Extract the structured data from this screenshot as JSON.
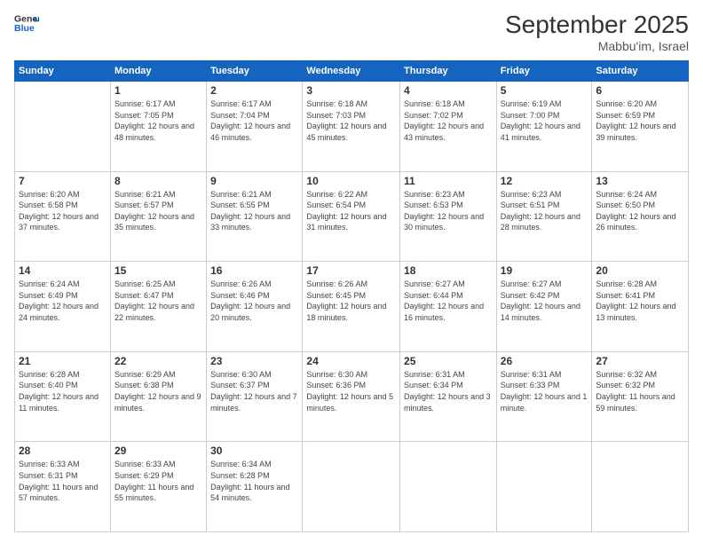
{
  "header": {
    "logo_line1": "General",
    "logo_line2": "Blue",
    "month_title": "September 2025",
    "location": "Mabbu'im, Israel"
  },
  "days_of_week": [
    "Sunday",
    "Monday",
    "Tuesday",
    "Wednesday",
    "Thursday",
    "Friday",
    "Saturday"
  ],
  "weeks": [
    [
      {
        "day": "",
        "sunrise": "",
        "sunset": "",
        "daylight": ""
      },
      {
        "day": "1",
        "sunrise": "Sunrise: 6:17 AM",
        "sunset": "Sunset: 7:05 PM",
        "daylight": "Daylight: 12 hours and 48 minutes."
      },
      {
        "day": "2",
        "sunrise": "Sunrise: 6:17 AM",
        "sunset": "Sunset: 7:04 PM",
        "daylight": "Daylight: 12 hours and 46 minutes."
      },
      {
        "day": "3",
        "sunrise": "Sunrise: 6:18 AM",
        "sunset": "Sunset: 7:03 PM",
        "daylight": "Daylight: 12 hours and 45 minutes."
      },
      {
        "day": "4",
        "sunrise": "Sunrise: 6:18 AM",
        "sunset": "Sunset: 7:02 PM",
        "daylight": "Daylight: 12 hours and 43 minutes."
      },
      {
        "day": "5",
        "sunrise": "Sunrise: 6:19 AM",
        "sunset": "Sunset: 7:00 PM",
        "daylight": "Daylight: 12 hours and 41 minutes."
      },
      {
        "day": "6",
        "sunrise": "Sunrise: 6:20 AM",
        "sunset": "Sunset: 6:59 PM",
        "daylight": "Daylight: 12 hours and 39 minutes."
      }
    ],
    [
      {
        "day": "7",
        "sunrise": "Sunrise: 6:20 AM",
        "sunset": "Sunset: 6:58 PM",
        "daylight": "Daylight: 12 hours and 37 minutes."
      },
      {
        "day": "8",
        "sunrise": "Sunrise: 6:21 AM",
        "sunset": "Sunset: 6:57 PM",
        "daylight": "Daylight: 12 hours and 35 minutes."
      },
      {
        "day": "9",
        "sunrise": "Sunrise: 6:21 AM",
        "sunset": "Sunset: 6:55 PM",
        "daylight": "Daylight: 12 hours and 33 minutes."
      },
      {
        "day": "10",
        "sunrise": "Sunrise: 6:22 AM",
        "sunset": "Sunset: 6:54 PM",
        "daylight": "Daylight: 12 hours and 31 minutes."
      },
      {
        "day": "11",
        "sunrise": "Sunrise: 6:23 AM",
        "sunset": "Sunset: 6:53 PM",
        "daylight": "Daylight: 12 hours and 30 minutes."
      },
      {
        "day": "12",
        "sunrise": "Sunrise: 6:23 AM",
        "sunset": "Sunset: 6:51 PM",
        "daylight": "Daylight: 12 hours and 28 minutes."
      },
      {
        "day": "13",
        "sunrise": "Sunrise: 6:24 AM",
        "sunset": "Sunset: 6:50 PM",
        "daylight": "Daylight: 12 hours and 26 minutes."
      }
    ],
    [
      {
        "day": "14",
        "sunrise": "Sunrise: 6:24 AM",
        "sunset": "Sunset: 6:49 PM",
        "daylight": "Daylight: 12 hours and 24 minutes."
      },
      {
        "day": "15",
        "sunrise": "Sunrise: 6:25 AM",
        "sunset": "Sunset: 6:47 PM",
        "daylight": "Daylight: 12 hours and 22 minutes."
      },
      {
        "day": "16",
        "sunrise": "Sunrise: 6:26 AM",
        "sunset": "Sunset: 6:46 PM",
        "daylight": "Daylight: 12 hours and 20 minutes."
      },
      {
        "day": "17",
        "sunrise": "Sunrise: 6:26 AM",
        "sunset": "Sunset: 6:45 PM",
        "daylight": "Daylight: 12 hours and 18 minutes."
      },
      {
        "day": "18",
        "sunrise": "Sunrise: 6:27 AM",
        "sunset": "Sunset: 6:44 PM",
        "daylight": "Daylight: 12 hours and 16 minutes."
      },
      {
        "day": "19",
        "sunrise": "Sunrise: 6:27 AM",
        "sunset": "Sunset: 6:42 PM",
        "daylight": "Daylight: 12 hours and 14 minutes."
      },
      {
        "day": "20",
        "sunrise": "Sunrise: 6:28 AM",
        "sunset": "Sunset: 6:41 PM",
        "daylight": "Daylight: 12 hours and 13 minutes."
      }
    ],
    [
      {
        "day": "21",
        "sunrise": "Sunrise: 6:28 AM",
        "sunset": "Sunset: 6:40 PM",
        "daylight": "Daylight: 12 hours and 11 minutes."
      },
      {
        "day": "22",
        "sunrise": "Sunrise: 6:29 AM",
        "sunset": "Sunset: 6:38 PM",
        "daylight": "Daylight: 12 hours and 9 minutes."
      },
      {
        "day": "23",
        "sunrise": "Sunrise: 6:30 AM",
        "sunset": "Sunset: 6:37 PM",
        "daylight": "Daylight: 12 hours and 7 minutes."
      },
      {
        "day": "24",
        "sunrise": "Sunrise: 6:30 AM",
        "sunset": "Sunset: 6:36 PM",
        "daylight": "Daylight: 12 hours and 5 minutes."
      },
      {
        "day": "25",
        "sunrise": "Sunrise: 6:31 AM",
        "sunset": "Sunset: 6:34 PM",
        "daylight": "Daylight: 12 hours and 3 minutes."
      },
      {
        "day": "26",
        "sunrise": "Sunrise: 6:31 AM",
        "sunset": "Sunset: 6:33 PM",
        "daylight": "Daylight: 12 hours and 1 minute."
      },
      {
        "day": "27",
        "sunrise": "Sunrise: 6:32 AM",
        "sunset": "Sunset: 6:32 PM",
        "daylight": "Daylight: 11 hours and 59 minutes."
      }
    ],
    [
      {
        "day": "28",
        "sunrise": "Sunrise: 6:33 AM",
        "sunset": "Sunset: 6:31 PM",
        "daylight": "Daylight: 11 hours and 57 minutes."
      },
      {
        "day": "29",
        "sunrise": "Sunrise: 6:33 AM",
        "sunset": "Sunset: 6:29 PM",
        "daylight": "Daylight: 11 hours and 55 minutes."
      },
      {
        "day": "30",
        "sunrise": "Sunrise: 6:34 AM",
        "sunset": "Sunset: 6:28 PM",
        "daylight": "Daylight: 11 hours and 54 minutes."
      },
      {
        "day": "",
        "sunrise": "",
        "sunset": "",
        "daylight": ""
      },
      {
        "day": "",
        "sunrise": "",
        "sunset": "",
        "daylight": ""
      },
      {
        "day": "",
        "sunrise": "",
        "sunset": "",
        "daylight": ""
      },
      {
        "day": "",
        "sunrise": "",
        "sunset": "",
        "daylight": ""
      }
    ]
  ]
}
